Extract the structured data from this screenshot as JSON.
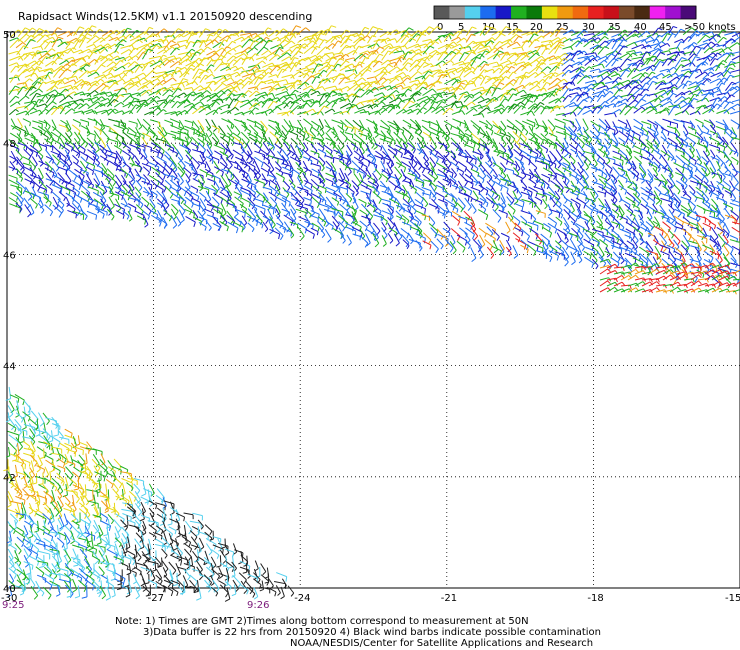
{
  "title": "Rapidsact Winds(12.5KM) v1.1 20150920 descending",
  "legend": {
    "labels": [
      "0",
      "5",
      "10",
      "15",
      "20",
      "25",
      "30",
      "35",
      "40",
      "45",
      ">50 knots"
    ],
    "colors": [
      "#595959",
      "#9a9a9a",
      "#55d0ee",
      "#1c6cf0",
      "#1818c8",
      "#20b020",
      "#0a7a0a",
      "#e8e010",
      "#f09a10",
      "#f06a10",
      "#e82020",
      "#c8101a",
      "#7a4a2a",
      "#4a2a12",
      "#f020f0",
      "#a010d0",
      "#4a0a78"
    ]
  },
  "map": {
    "lon_ticks": [
      "-30",
      "-27",
      "-24",
      "-21",
      "-18",
      "-15"
    ],
    "lat_ticks": [
      "50",
      "48",
      "46",
      "44",
      "42",
      "40"
    ],
    "lon_range": [
      -30,
      -15
    ],
    "lat_range": [
      40,
      50
    ],
    "grid": "dotted",
    "time_labels": [
      "9:25",
      "9:26"
    ]
  },
  "notes": {
    "line1": "Note: 1) Times are GMT 2)Times along bottom correspond to measurement at 50N",
    "line2": "3)Data buffer is 22 hrs from 20150920 4) Black wind barbs indicate possible contamination",
    "line3": "NOAA/NESDIS/Center for Satellite Applications and Research"
  },
  "wind_swaths": [
    {
      "name": "northern swath upper band",
      "color_scale_knots": [
        20,
        30
      ]
    },
    {
      "name": "northern swath middle band",
      "color_scale_knots": [
        15,
        25
      ]
    },
    {
      "name": "northern swath lower band",
      "color_scale_knots": [
        10,
        20
      ]
    },
    {
      "name": "southwest swath",
      "color_scale_knots": [
        0,
        30
      ],
      "contamination": true
    }
  ]
}
